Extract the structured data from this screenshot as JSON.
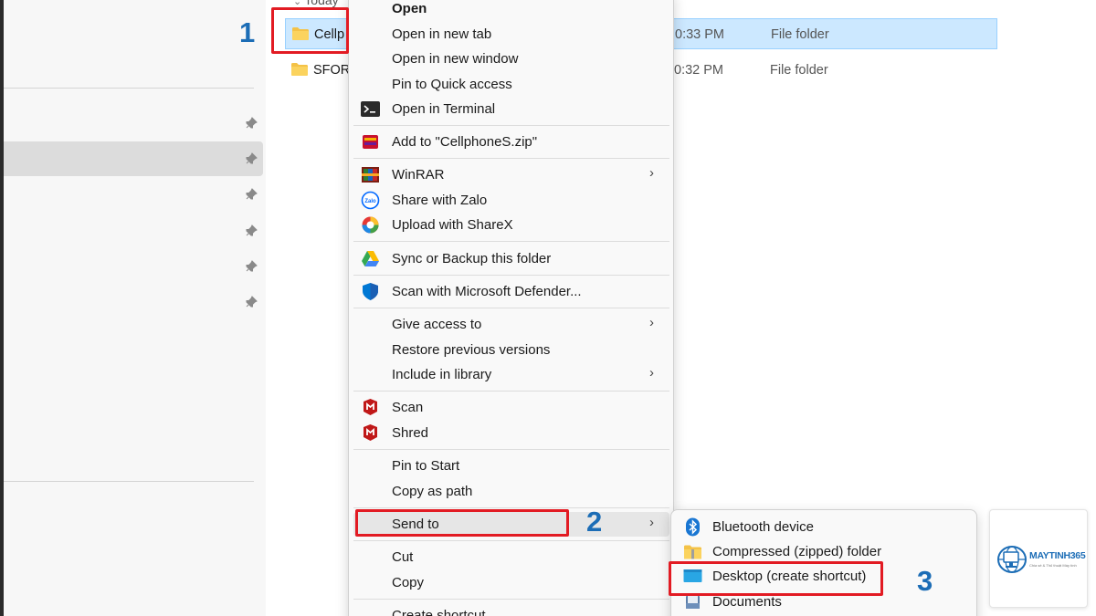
{
  "explorer": {
    "group_header": "Today",
    "files": [
      {
        "name": "Cellp",
        "date": "0:33 PM",
        "type": "File folder"
      },
      {
        "name": "SFOR",
        "date": "0:32 PM",
        "type": "File folder"
      }
    ]
  },
  "context_menu": {
    "open": "Open",
    "open_new_tab": "Open in new tab",
    "open_new_window": "Open in new window",
    "pin_quick_access": "Pin to Quick access",
    "open_terminal": "Open in Terminal",
    "add_to_zip": "Add to \"CellphoneS.zip\"",
    "winrar": "WinRAR",
    "share_zalo": "Share with Zalo",
    "upload_sharex": "Upload with ShareX",
    "sync_backup": "Sync or Backup this folder",
    "scan_defender": "Scan with Microsoft Defender...",
    "give_access": "Give access to",
    "restore_versions": "Restore previous versions",
    "include_library": "Include in library",
    "scan": "Scan",
    "shred": "Shred",
    "pin_start": "Pin to Start",
    "copy_path": "Copy as path",
    "send_to": "Send to",
    "cut": "Cut",
    "copy": "Copy",
    "create_shortcut": "Create shortcut"
  },
  "send_to_menu": {
    "bluetooth": "Bluetooth device",
    "compressed": "Compressed (zipped) folder",
    "desktop": "Desktop (create shortcut)",
    "documents": "Documents"
  },
  "annotations": {
    "step1": "1",
    "step2": "2",
    "step3": "3"
  },
  "logo": {
    "brand": "MAYTINH365",
    "tagline": "Chia sẻ & Thủ thuật Máy tính"
  },
  "colors": {
    "highlight": "#e21b23",
    "step_number": "#1c6db6",
    "selection_bg": "#cce8ff"
  }
}
